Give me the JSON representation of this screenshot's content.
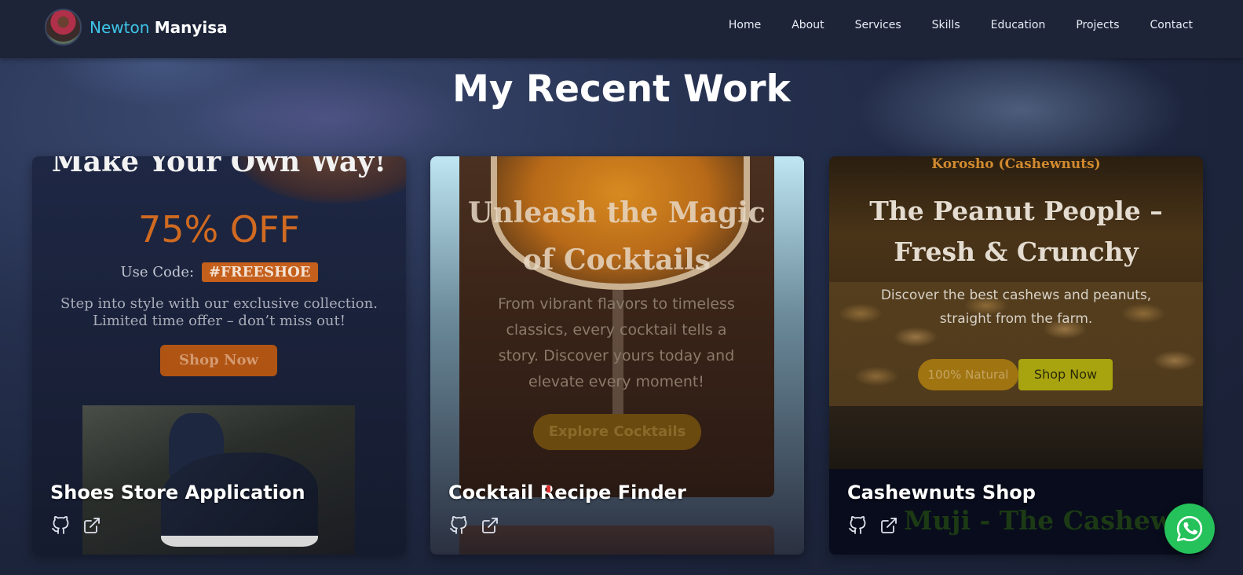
{
  "brand": {
    "first": "Newton",
    "last": "Manyisa"
  },
  "nav": {
    "links": [
      "Home",
      "About",
      "Services",
      "Skills",
      "Education",
      "Projects",
      "Contact"
    ]
  },
  "section": {
    "title": "My Recent Work"
  },
  "projects": [
    {
      "title": "Shoes Store Application",
      "preview": {
        "headline": "Make Your Own Way!",
        "offer": "75% OFF",
        "code_label": "Use Code:",
        "code": "#FREESHOE",
        "description_line1": "Step into style with our exclusive collection.",
        "description_line2": "Limited time offer – don’t miss out!",
        "button": "Shop Now"
      }
    },
    {
      "title": "Cocktail Recipe Finder",
      "preview": {
        "headline_line1": "Unleash the Magic",
        "headline_line2": "of Cocktails",
        "description_line1": "From vibrant flavors to timeless",
        "description_line2": "classics, every cocktail tells a",
        "description_line3": "story. Discover yours today and",
        "description_line4": "elevate every moment!",
        "button": "Explore Cocktails"
      }
    },
    {
      "title": "Cashewnuts Shop",
      "preview": {
        "top_label": "Korosho (Cashewnuts)",
        "headline_line1": "The Peanut People –",
        "headline_line2": "Fresh & Crunchy",
        "description_line1": "Discover the best cashews and peanuts,",
        "description_line2": "straight from the farm.",
        "button_secondary": "100% Natural",
        "button_primary": "Shop Now",
        "peek_text": "Muji - The Cashew"
      }
    }
  ],
  "icons": {
    "github": "github-icon",
    "external": "external-link-icon",
    "whatsapp": "whatsapp-icon"
  },
  "colors": {
    "accent": "#3ec5e8",
    "whatsapp": "#25c15a",
    "nav_bg": "#1d2438"
  }
}
